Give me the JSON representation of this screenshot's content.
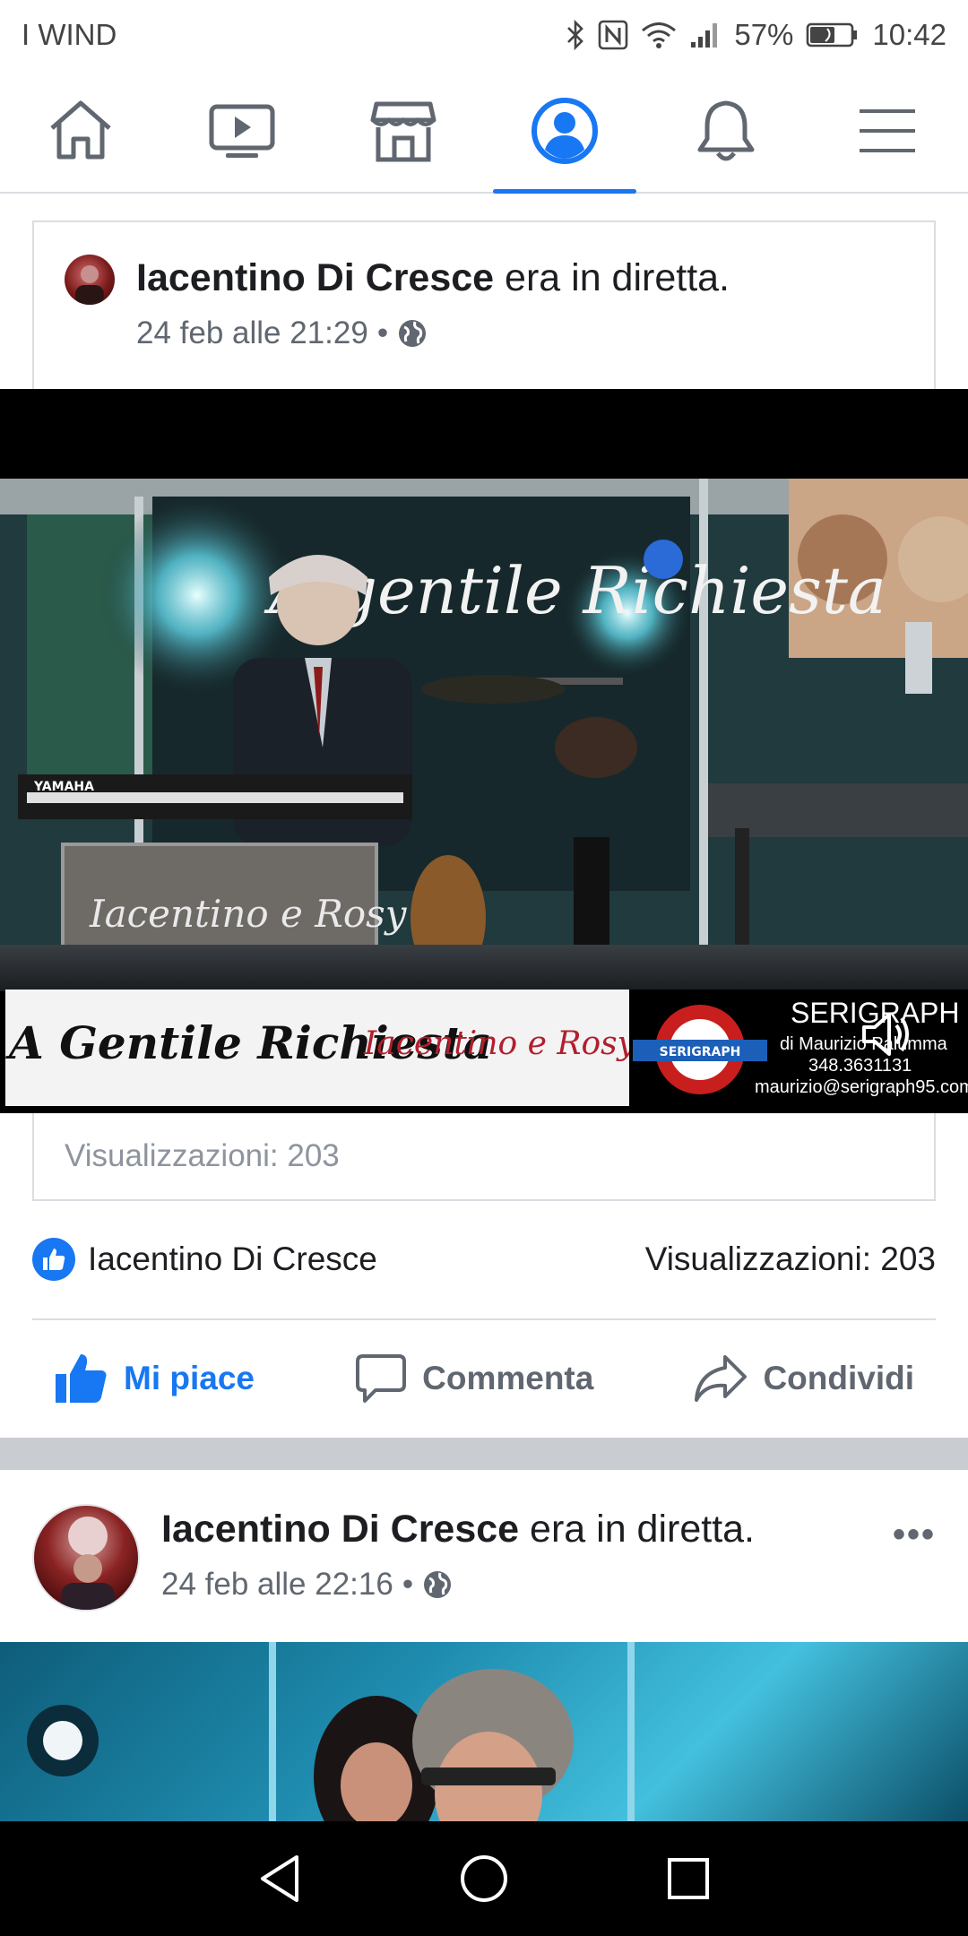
{
  "status_bar": {
    "carrier": "I WIND",
    "battery_percent": "57%",
    "time": "10:42",
    "icons": [
      "bluetooth-icon",
      "nfc-icon",
      "wifi-icon",
      "signal-icon",
      "battery-icon"
    ]
  },
  "nav": {
    "tabs": [
      {
        "name": "home",
        "icon": "home-icon"
      },
      {
        "name": "watch",
        "icon": "video-icon"
      },
      {
        "name": "marketplace",
        "icon": "store-icon"
      },
      {
        "name": "profile",
        "icon": "profile-icon",
        "active": true
      },
      {
        "name": "notifications",
        "icon": "bell-icon"
      },
      {
        "name": "menu",
        "icon": "hamburger-icon"
      }
    ],
    "accent": "#1877f2"
  },
  "post1": {
    "author": "Iacentino Di Cresce",
    "action": " era in diretta.",
    "date": "24 feb alle 21:29",
    "separator": "•",
    "privacy_icon": "globe-icon",
    "video": {
      "overlay_banner": "A gentile Richiesta",
      "lower_third_title": "A Gentile Richiesta",
      "lower_third_signature": "Iacentino e Rosy",
      "brand_logo_text": "SERIGRAPH",
      "sponsor_name": "SERIGRAPH",
      "sponsor_line1": "di Maurizio Palumma",
      "sponsor_phone": "348.3631131",
      "sponsor_email": "maurizio@serigraph95.com",
      "keyboard_brand": "YAMAHA",
      "mute_icon": "speaker-muted-icon"
    },
    "views_caption": "Visualizzazioni: 203",
    "reactions": {
      "liked_by": "Iacentino Di Cresce",
      "views": "Visualizzazioni: 203"
    },
    "actions": {
      "like": "Mi piace",
      "comment": "Commenta",
      "share": "Condividi"
    }
  },
  "post2": {
    "author": "Iacentino Di Cresce",
    "action": " era in diretta.",
    "date": "24 feb alle 22:16",
    "separator": "•",
    "privacy_icon": "globe-icon",
    "more": "•••"
  },
  "system_nav": [
    "back-icon",
    "home-circle-icon",
    "recents-icon"
  ]
}
